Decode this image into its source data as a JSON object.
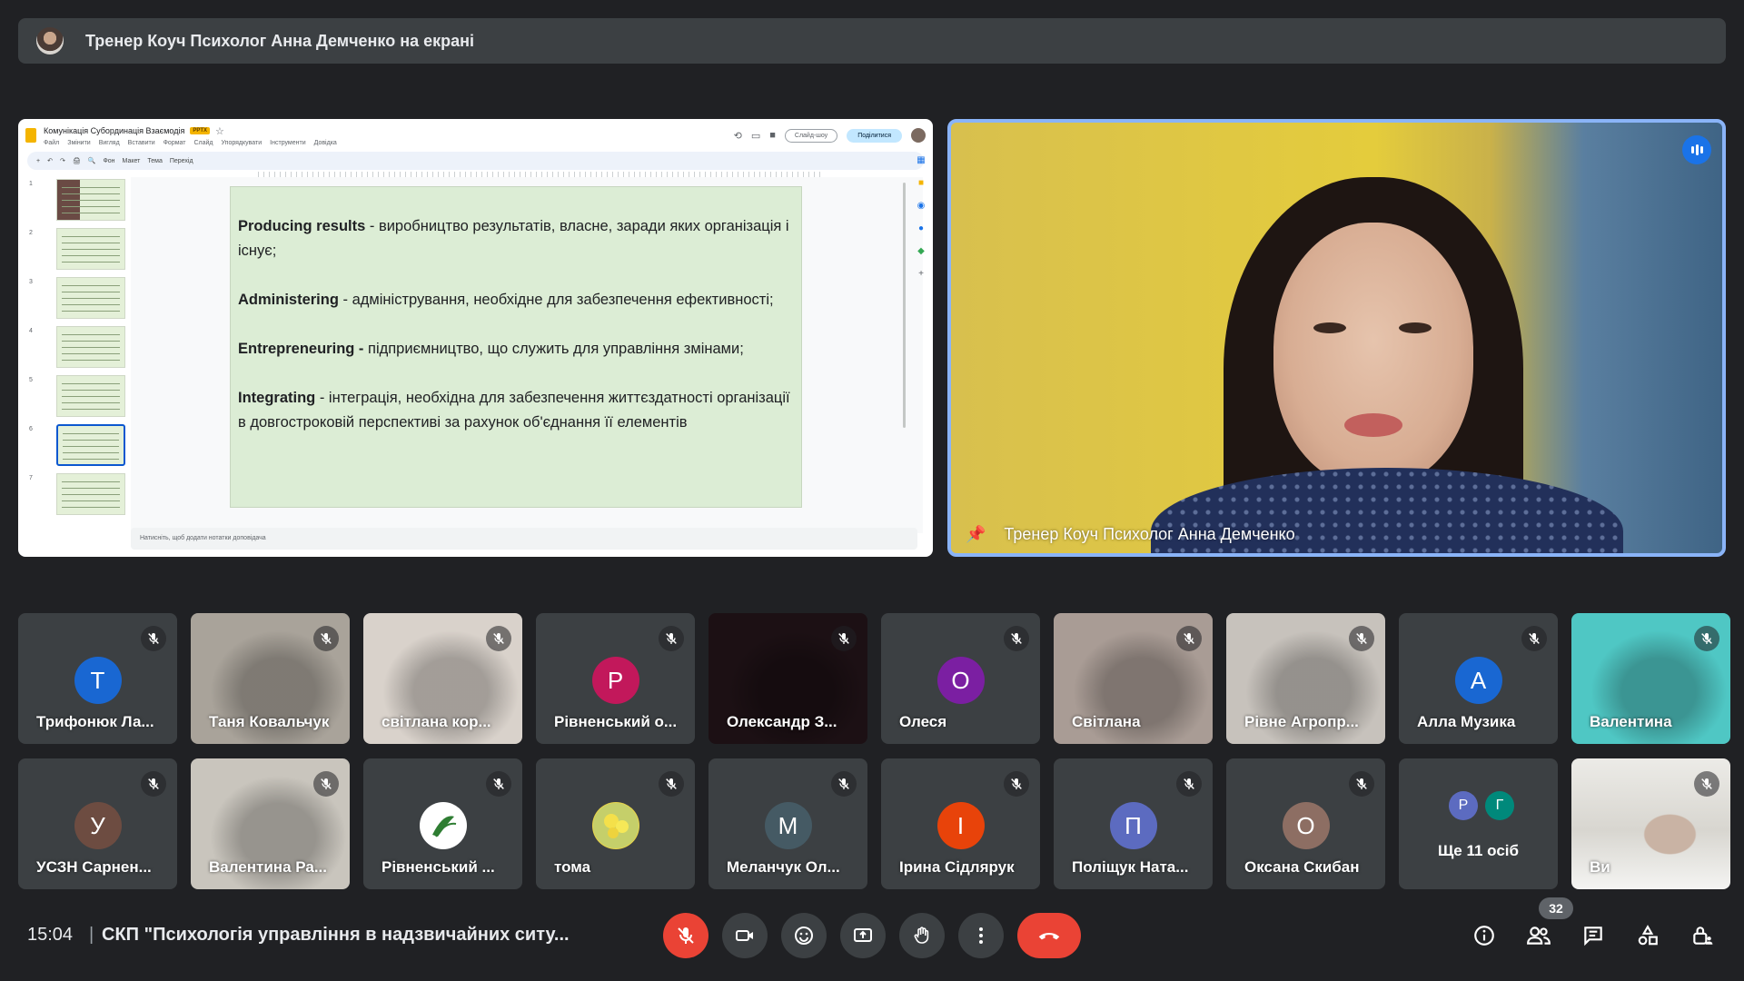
{
  "banner": {
    "text": "Тренер Коуч Психолог Анна Демченко на екрані"
  },
  "slides_app": {
    "doc_title": "Комунікація Субординація Взаємодія",
    "doc_badge": "PPTX",
    "menu": [
      "Файл",
      "Змінити",
      "Вигляд",
      "Вставити",
      "Формат",
      "Слайд",
      "Упорядкувати",
      "Інструменти",
      "Довідка"
    ],
    "slideshow_label": "Слайд-шоу",
    "share_label": "Поділитися",
    "toolbar": [
      "Фон",
      "Макет",
      "Тема",
      "Перехід"
    ],
    "thumb_numbers": [
      "1",
      "2",
      "3",
      "4",
      "5",
      "6",
      "7"
    ],
    "selected_slide": "6",
    "notes_placeholder": "Натисніть, щоб додати нотатки доповідача",
    "slide_paragraphs": [
      {
        "term": "Producing results",
        "text": " - виробництво результатів, власне, заради яких організація і існує;"
      },
      {
        "term": "Administering",
        "text": " - адміністрування, необхідне для забезпечення ефективності;"
      },
      {
        "term": "Entrepreneuring -",
        "text": " підприємництво, що служить для управління змінами;"
      },
      {
        "term": "Integrating",
        "text": " - інтеграція, необхідна для забезпечення життєздатності організації в довгостроковій перспективі за рахунок об'єднання її елементів"
      }
    ]
  },
  "speaker": {
    "name": "Тренер Коуч Психолог Анна Демченко"
  },
  "participants": [
    {
      "name": "Трифонюк Ла...",
      "initial": "Т",
      "color": "#1967d2",
      "video": false
    },
    {
      "name": "Таня Ковальчук",
      "initial": "",
      "color": "",
      "video": true,
      "bg": "#a9a39a"
    },
    {
      "name": "світлана кор...",
      "initial": "",
      "color": "",
      "video": true,
      "bg": "#d9d2cb"
    },
    {
      "name": "Рівненський о...",
      "initial": "Р",
      "color": "#c2185b",
      "video": false
    },
    {
      "name": "Олександр З...",
      "initial": "",
      "color": "",
      "video": true,
      "bg": "#1c1014"
    },
    {
      "name": "Олеся",
      "initial": "О",
      "color": "#7b1fa2",
      "video": false
    },
    {
      "name": "Світлана",
      "initial": "",
      "color": "",
      "video": true,
      "bg": "#a99c95"
    },
    {
      "name": "Рівне Агропр...",
      "initial": "",
      "color": "",
      "video": true,
      "bg": "#c7c2bc"
    },
    {
      "name": "Алла Музика",
      "initial": "А",
      "color": "#1967d2",
      "video": false
    },
    {
      "name": "Валентина",
      "initial": "",
      "color": "",
      "video": true,
      "bg": "#4fc7c4"
    },
    {
      "name": "УСЗН Сарнен...",
      "initial": "У",
      "color": "#6d4c41",
      "video": false
    },
    {
      "name": "Валентина Ра...",
      "initial": "",
      "color": "",
      "video": true,
      "bg": "#c9c5bd"
    },
    {
      "name": "Рівненський ...",
      "initial": "",
      "color": "#ffffff",
      "video": false,
      "logo": true
    },
    {
      "name": "тома",
      "initial": "",
      "color": "#e8d44a",
      "video": false,
      "flower": true
    },
    {
      "name": "Меланчук Ол...",
      "initial": "М",
      "color": "#455a64",
      "video": false
    },
    {
      "name": "Ірина Сідлярук",
      "initial": "І",
      "color": "#e8430a",
      "video": false
    },
    {
      "name": "Поліщук Ната...",
      "initial": "П",
      "color": "#5c6bc0",
      "video": false
    },
    {
      "name": "Оксана Скибан",
      "initial": "О",
      "color": "#8d6e63",
      "video": false
    }
  ],
  "more_tile": {
    "label": "Ще 11 осіб",
    "initials": [
      "Р",
      "Г"
    ],
    "colors": [
      "#5c6bc0",
      "#00897b"
    ]
  },
  "self_tile": {
    "name": "Ви"
  },
  "bottom_bar": {
    "time": "15:04",
    "separator": "|",
    "meeting_title": "СКП \"Психологія управління в надзвичайних ситу...",
    "participants_count": "32"
  }
}
